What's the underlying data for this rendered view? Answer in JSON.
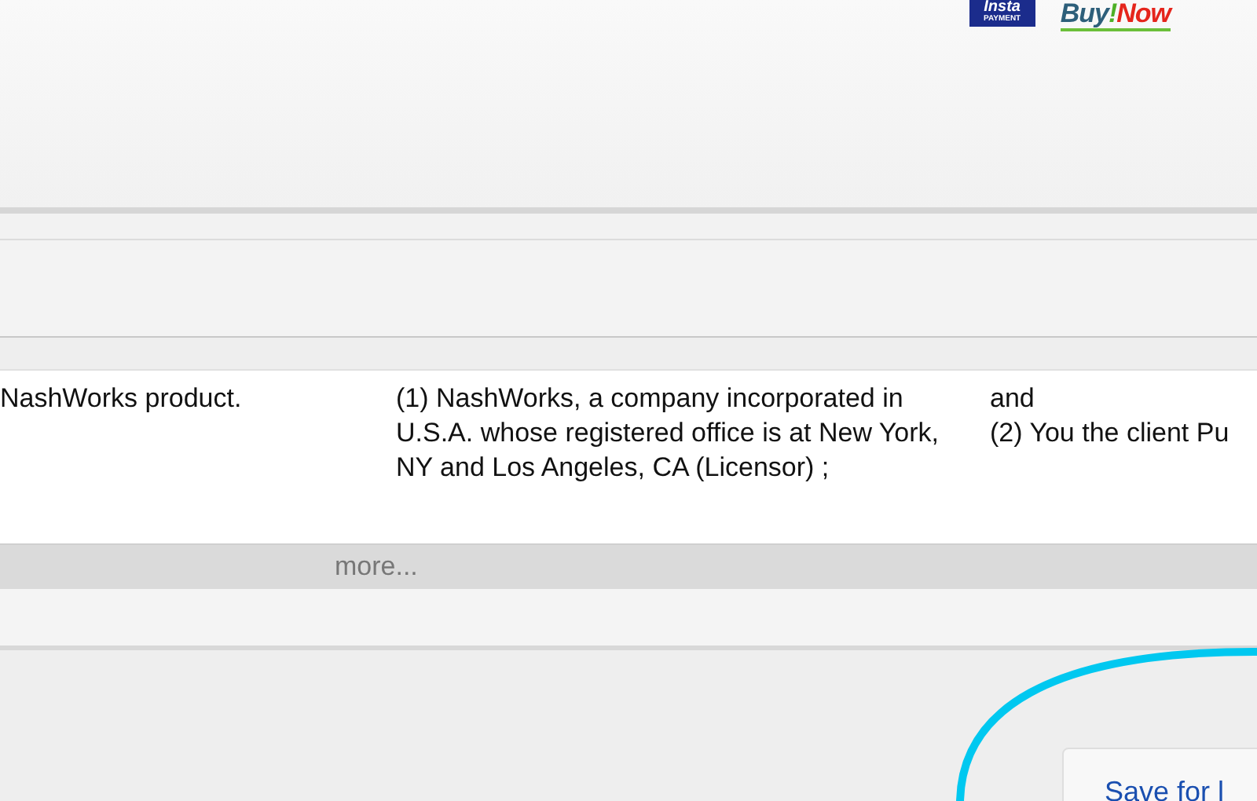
{
  "header": {
    "payment_logo": {
      "top": "Insta",
      "bottom": "PAYMENT"
    },
    "buy_logo": {
      "first": "Buy",
      "mark": "!",
      "second": "Now"
    }
  },
  "table": {
    "rows": [
      {
        "cells": [
          {
            "lines": [
              "NashWorks product."
            ]
          },
          {
            "lines": [
              "(1) NashWorks, a company incorporated in U.S.A. whose registered office is at New York, NY and Los Angeles, CA (Licensor) ;"
            ]
          },
          {
            "lines": [
              "and",
              "(2) You the client Pu"
            ]
          }
        ]
      }
    ],
    "more": "more..."
  },
  "footer": {
    "save_button": "Save for l"
  }
}
